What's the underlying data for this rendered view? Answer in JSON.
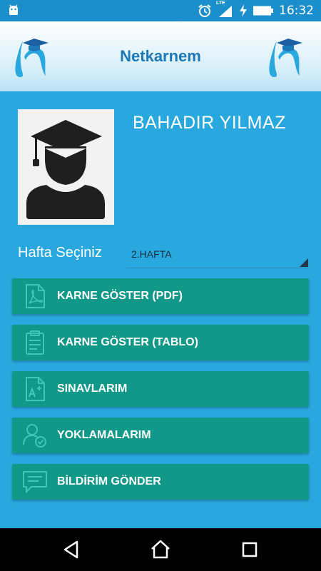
{
  "status_bar": {
    "time": "16:32",
    "network": "LTE"
  },
  "header": {
    "title": "Netkarnem",
    "brand_color": "#1d78b7"
  },
  "profile": {
    "name": "BAHADIR YILMAZ"
  },
  "week": {
    "label": "Hafta Seçiniz",
    "selected": "2.HAFTA"
  },
  "menu": [
    {
      "label": "KARNE GÖSTER (PDF)",
      "icon": "pdf-icon"
    },
    {
      "label": "KARNE GÖSTER (TABLO)",
      "icon": "clipboard-icon"
    },
    {
      "label": "SINAVLARIM",
      "icon": "exam-grade-icon"
    },
    {
      "label": "YOKLAMALARIM",
      "icon": "attendance-icon"
    },
    {
      "label": "BİLDİRİM GÖNDER",
      "icon": "message-icon"
    }
  ],
  "colors": {
    "background": "#29a8df",
    "button": "#119889",
    "icon": "#3fc7b8",
    "status_bar": "#1b8fcb"
  }
}
